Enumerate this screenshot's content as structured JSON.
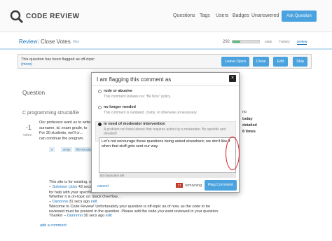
{
  "header": {
    "logo_text": "CODE REVIEW",
    "nav": [
      "Questions",
      "Tags",
      "Users",
      "Badges",
      "Unanswered"
    ],
    "ask_label": "Ask Question"
  },
  "review": {
    "title": "Review",
    "queue": "Close Votes",
    "filter": "filter",
    "count": "292",
    "progress": 0.3,
    "tabs": [
      "stats",
      "history",
      "review"
    ],
    "active_tab": "review"
  },
  "flag_banner": {
    "text_prefix": "This question has been flagged as ",
    "reason": "off-topic",
    "more": "(more)",
    "buttons": [
      "Leave Open",
      "Close",
      "Edit",
      "Skip"
    ]
  },
  "question": {
    "heading": "Question",
    "title": "C programming struct&file",
    "votes": "-1",
    "votes_label": "votes",
    "body": [
      "Our professor want us to write",
      "surname, id, exam grade, to",
      "For 30 students, we'll cr...",
      "can continue the program."
    ],
    "tags": [
      "c",
      "array",
      "file-structure"
    ],
    "side_stats": [
      "no",
      "today",
      "detailed",
      "8 times"
    ]
  },
  "comments": [
    {
      "line1": "This site is for existing, working code...",
      "author": "Solomon Ucko",
      "date": "43 secs ago",
      "action": "edit"
    },
    {
      "line1": "for help with your specific...",
      "author": "",
      "date": "",
      "action": ""
    },
    {
      "line1": "Whether it is on-topic on Stack Overflow...",
      "author": "Dannnno",
      "date": "31 secs ago",
      "action": "edit"
    },
    {
      "line1": "Welcome to Code Review! Unfortunately your question is off-topic as of now, as the code to be",
      "line2": "reviewed must be present in the question. Please add the code you want reviewed in your question.",
      "line3": "Thanks!",
      "author": "Dannnno",
      "date": "30 secs ago",
      "action": "edit"
    }
  ],
  "add_comment": "add a comment",
  "dialog": {
    "title": "I am flagging this comment as",
    "close": "×",
    "options": [
      {
        "label": "rude or abusive",
        "desc": "This comment violates our \"Be Nice\" policy.",
        "selected": false
      },
      {
        "label": "no longer needed",
        "desc": "This comment is outdated, chatty, or otherwise unnecessary.",
        "selected": false
      },
      {
        "label": "in need of moderator intervention",
        "desc": "A problem not listed above that requires action by a moderator. Be specific and detailed!",
        "selected": true
      }
    ],
    "message": "Let's not encourage these questions being asked elsewhere; we don't like it when that stuff gets sent our way.",
    "chars_left": "80 characters left",
    "cancel": "cancel",
    "remaining_count": "17",
    "remaining_label": "remaining",
    "submit": "Flag Comment"
  }
}
